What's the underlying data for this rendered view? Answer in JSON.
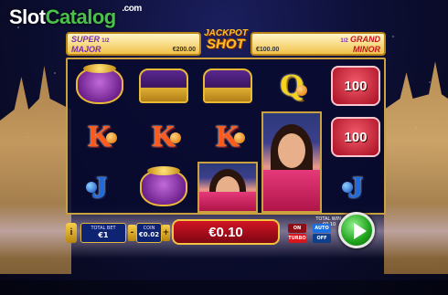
{
  "watermark": {
    "slot": "Slot",
    "catalog": "Catalog",
    "com": ".com"
  },
  "jackpot": {
    "logo_line1": "JACKPOT",
    "logo_line2": "SHOT",
    "super_label": "SUPER",
    "super_odds": "1/2",
    "major_label": "MAJOR",
    "major_value": "€200.00",
    "grand_label": "GRAND",
    "grand_odds": "1/2",
    "minor_label": "MINOR",
    "minor_value": "€100.00"
  },
  "reels": [
    [
      "pouch",
      "K",
      "J"
    ],
    [
      "chest",
      "K",
      "pouch"
    ],
    [
      "chest",
      "K",
      "princess"
    ],
    [
      "Q",
      "princess_tall",
      "princess_tall"
    ],
    [
      "100",
      "100",
      "J"
    ]
  ],
  "symbols": {
    "hundred_label": "100",
    "K_label": "K",
    "J_label": "J",
    "Q_label": "Q"
  },
  "controls": {
    "info_label": "i",
    "total_bet_label": "TOTAL BET",
    "total_bet_value": "€1",
    "coin_label": "COIN",
    "coin_value": "€0.02",
    "minus_label": "-",
    "plus_label": "+",
    "win_value": "€0.10",
    "total_win_label": "TOTAL WIN: €0.10",
    "on_label": "ON",
    "turbo_label": "TURBO",
    "auto_label": "AUTO",
    "off_label": "OFF",
    "bottom_colors": {
      "turbo": "#d8161e",
      "auto": "#1a6fe0"
    }
  }
}
